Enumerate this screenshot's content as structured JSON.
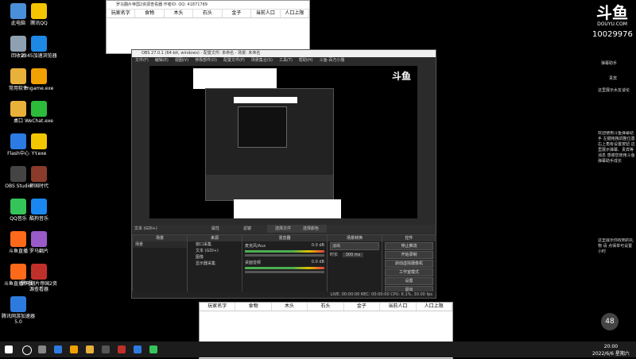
{
  "desktop_icons": [
    {
      "label": "此电脑",
      "color": "#4a90d9"
    },
    {
      "label": "腾讯QQ",
      "color": "#f5c400"
    },
    {
      "label": "回收站",
      "color": "#8fa0b0"
    },
    {
      "label": "2345加速浏览器",
      "color": "#1e88e5"
    },
    {
      "label": "常用软件",
      "color": "#e8b13a"
    },
    {
      "label": "cngame.exe",
      "color": "#f0a000"
    },
    {
      "label": "桌口",
      "color": "#e8b13a"
    },
    {
      "label": "WeChat.exe",
      "color": "#2dbb3b"
    },
    {
      "label": "Flash中心",
      "color": "#2b7be3"
    },
    {
      "label": "YY.exe",
      "color": "#f3c700"
    },
    {
      "label": "OBS Studio",
      "color": "#444444"
    },
    {
      "label": "帝国时代",
      "color": "#8a3b2a"
    },
    {
      "label": "QQ音乐",
      "color": "#35c45a"
    },
    {
      "label": "酷狗音乐",
      "color": "#1a87f0"
    },
    {
      "label": "斗鱼直播",
      "color": "#ff6a1a"
    },
    {
      "label": "罗马翻片",
      "color": "#9a5ac8"
    },
    {
      "label": "斗鱼直播伴侣",
      "color": "#ff6a1a"
    },
    {
      "label": "罗马翻片帝国2资源查看器",
      "color": "#c0302a"
    },
    {
      "label": "腾讯网游加速器5.0",
      "color": "#2e7be0"
    }
  ],
  "top_window": {
    "title": "罗马翻片帝国2资源查看器  作者ID:  QQ: 41871789",
    "columns": [
      "玩家名字",
      "食物",
      "木头",
      "石头",
      "金子",
      "当前人口",
      "人口上限"
    ]
  },
  "bottom_window": {
    "columns": [
      "玩家名字",
      "食物",
      "木头",
      "石头",
      "金子",
      "当前人口",
      "人口上限"
    ]
  },
  "obs": {
    "title": "OBS 27.0.1 (64-bit, windows) - 配置文件: 未命名 - 场景: 未命名",
    "menu": [
      "文件(F)",
      "编辑(E)",
      "视图(V)",
      "停靠部件(D)",
      "配置文件(P)",
      "场景集合(S)",
      "工具(T)",
      "帮助(H)",
      "斗鱼-百万小撸"
    ],
    "source_bar": {
      "label": "文本 (GDI+)",
      "props": "属性",
      "filters": "滤镜",
      "select_file": "选择文件",
      "choose_color": "选择颜色"
    },
    "docks": {
      "scenes": "场景",
      "sources": "来源",
      "mixer": "混音器",
      "transitions": "场景转换",
      "controls": "控件"
    },
    "scene_items": [
      "场景"
    ],
    "source_items": [
      "窗口采集",
      "文本 (GDI+)",
      "图像",
      "显示器采集"
    ],
    "mixer_items": [
      {
        "name": "麦克风/Aux",
        "db": "0.0 dB"
      },
      {
        "name": "桌面音频",
        "db": "0.0 dB"
      }
    ],
    "transition": {
      "type": "淡出",
      "duration_label": "时长",
      "duration": "300 ms"
    },
    "controls": [
      "停止推流",
      "开始录制",
      "启动虚拟摄像机",
      "工作室模式",
      "设置",
      "退出"
    ],
    "status": "LIVE: 00:00:00    REC: 00:00:00    CPU: 6.1%, 30.00 fps"
  },
  "douyu": {
    "logo": "斗鱼",
    "domain": "DOUYU.COM",
    "room_id": "10029976"
  },
  "chat": [
    "这里展示水友谈论",
    "欢迎使用斗鱼弹幕助手 左键拖拽调整位置 右上角有设置按钮 这里展示弹幕、贵宾等消息 感谢您使用斗鱼弹幕助手成长",
    "这里展示你收到的礼物 请 点保单可设置小时"
  ],
  "chat_headers": [
    "弹幕助手",
    "贵宾"
  ],
  "net_badge": "48",
  "clock": {
    "time": "20:00",
    "date": "2022/6/6 星期六"
  }
}
